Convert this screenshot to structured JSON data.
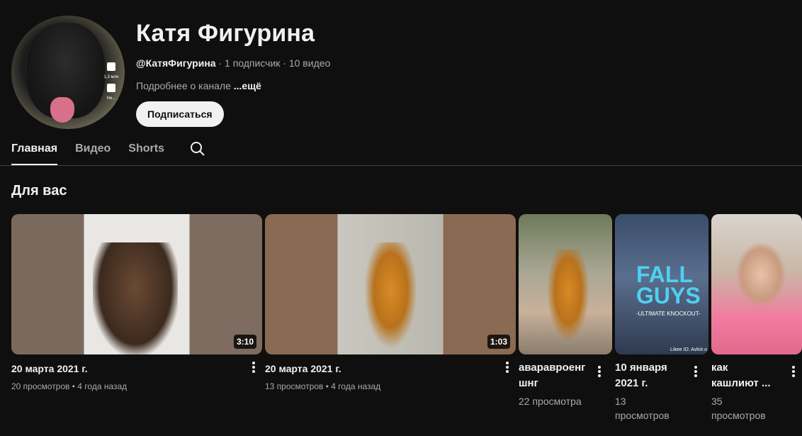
{
  "channel": {
    "title": "Катя Фигурина",
    "handle": "@КатяФигурина",
    "meta": " · 1 подписчик · 10 видео",
    "desc": "Подробнее о канале ",
    "more": "...ещё",
    "subscribe_label": "Подписаться"
  },
  "tabs": [
    {
      "label": "Главная"
    },
    {
      "label": "Видео"
    },
    {
      "label": "Shorts"
    }
  ],
  "section": {
    "title": "Для вас"
  },
  "videos": [
    {
      "title": "20 марта 2021 г.",
      "views": "20 просмотров",
      "age": "4 года назад",
      "duration": "3:10"
    },
    {
      "title": "20 марта 2021 г.",
      "views": "13 просмотров",
      "age": "4 года назад",
      "duration": "1:03"
    }
  ],
  "shorts": [
    {
      "title_l1": "аваравроенг",
      "title_l2": "шнг",
      "views_l1": "22 просмотра",
      "views_l2": ""
    },
    {
      "title_l1": "10 января",
      "title_l2": "2021 г.",
      "views_l1": "13",
      "views_l2": "просмотров"
    },
    {
      "title_l1": "как",
      "title_l2": "кашлиют ...",
      "views_l1": "35",
      "views_l2": "просмотров"
    }
  ],
  "thumb_art": {
    "fall_guys_l1": "FALL",
    "fall_guys_l2": "GUYS",
    "fall_guys_l3": "-ULTIMATE KNOCKOUT-",
    "likee": "Likee ID: Avlnir.o"
  },
  "avatar_overlay": {
    "likes": "1,3 млн",
    "dislikes": "Не..."
  },
  "colors": {
    "background": "#0f0f0f",
    "text": "#f1f1f1",
    "secondary": "#aaaaaa"
  }
}
